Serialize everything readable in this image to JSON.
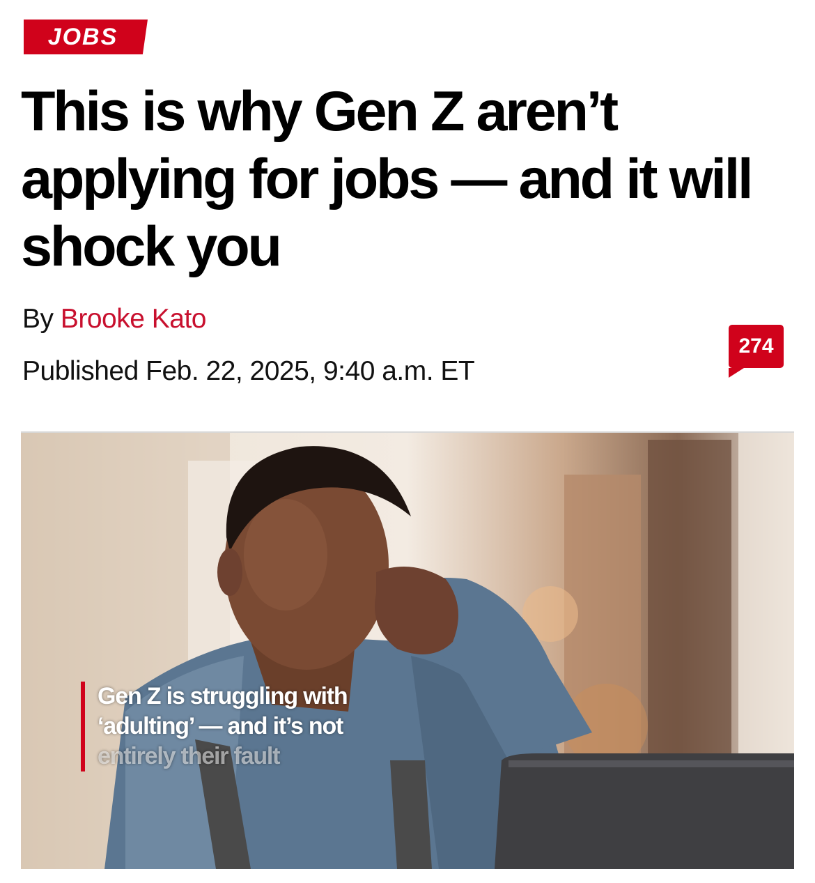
{
  "category": {
    "label": "JOBS"
  },
  "article": {
    "headline": "This is why Gen Z aren’t applying for jobs — and it will shock you",
    "byline_prefix": "By",
    "author": "Brooke Kato",
    "published": "Published Feb. 22, 2025, 9:40 a.m. ET",
    "comment_count": "274"
  },
  "video": {
    "caption_line1": "Gen Z is struggling with",
    "caption_line2": "‘adulting’ — and it’s not",
    "caption_line3": "entirely their fault"
  },
  "colors": {
    "accent_red": "#d0021b",
    "author_red": "#c8102e",
    "text": "#000000"
  }
}
